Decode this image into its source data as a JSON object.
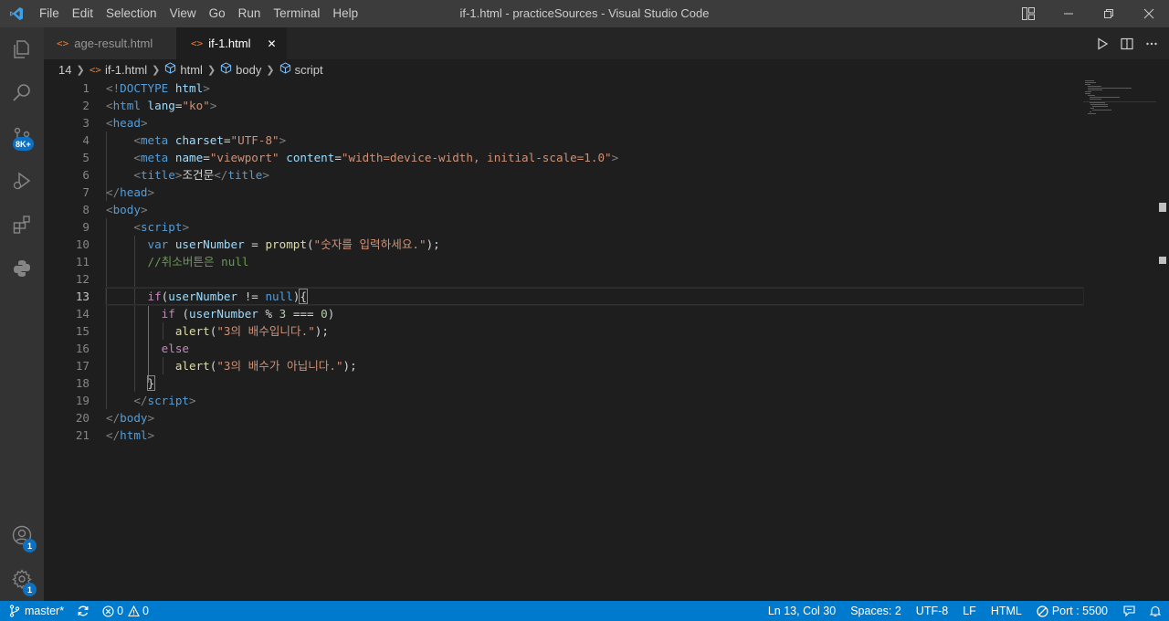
{
  "title": "if-1.html - practiceSources - Visual Studio Code",
  "menu": [
    "File",
    "Edit",
    "Selection",
    "View",
    "Go",
    "Run",
    "Terminal",
    "Help"
  ],
  "activity": {
    "source_control_badge": "8K+",
    "accounts_badge": "1",
    "settings_badge": "1"
  },
  "tabs": [
    {
      "label": "age-result.html",
      "active": false
    },
    {
      "label": "if-1.html",
      "active": true,
      "close": "✕"
    }
  ],
  "breadcrumbs": {
    "line": "14",
    "file": "if-1.html",
    "html": "html",
    "body": "body",
    "script": "script"
  },
  "editor": {
    "current_line": 13,
    "line_numbers": [
      "1",
      "2",
      "3",
      "4",
      "5",
      "6",
      "7",
      "8",
      "9",
      "10",
      "11",
      "12",
      "13",
      "14",
      "15",
      "16",
      "17",
      "18",
      "19",
      "20",
      "21"
    ]
  },
  "statusbar": {
    "branch": "master*",
    "errors": "0",
    "warnings": "0",
    "position": "Ln 13, Col 30",
    "spaces": "Spaces: 2",
    "encoding": "UTF-8",
    "eol": "LF",
    "language": "HTML",
    "port": "Port : 5500"
  },
  "colors": {
    "statusbar": "#007acc",
    "editor_bg": "#1e1e1e",
    "activitybar": "#333333",
    "titlebar": "#3c3c3c",
    "badge": "#0e70c0"
  }
}
